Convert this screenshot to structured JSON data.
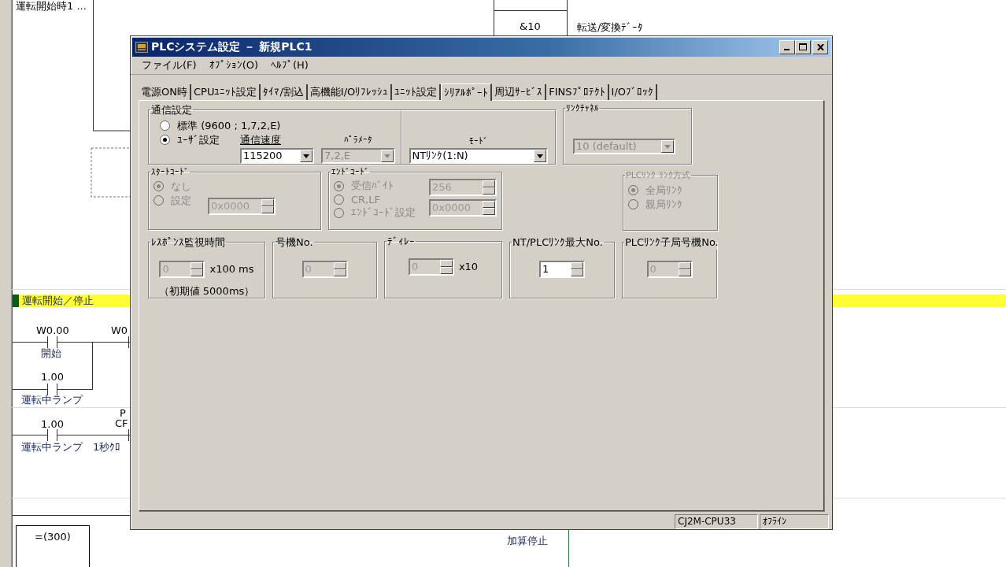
{
  "ladder": {
    "section_title": "運転開始／停止",
    "texts": [
      "運転開始時1 ...",
      "&10",
      "転送/変換ﾃﾞｰﾀ",
      "W0.00",
      "開始",
      "W0",
      "1.00",
      "運転中ランプ",
      "1.00",
      "運転中ランプ",
      "P",
      "CF",
      "1秒ｸﾛ",
      "加算停止"
    ],
    "compare_block": "=(300)"
  },
  "window": {
    "title": "PLCシステム設定 － 新規PLC1"
  },
  "menu": [
    "ファイル(F)",
    "ｵﾌﾟｼｮﾝ(O)",
    "ﾍﾙﾌﾟ(H)"
  ],
  "tabs": [
    {
      "label": "電源ON時",
      "selected": false
    },
    {
      "label": "CPUﾕﾆｯﾄ設定",
      "selected": false
    },
    {
      "label": "ﾀｲﾏ/割込",
      "selected": false
    },
    {
      "label": "高機能I/Oﾘﾌﾚｯｼｭ",
      "selected": false
    },
    {
      "label": "ﾕﾆｯﾄ設定",
      "selected": false
    },
    {
      "label": "ｼﾘｱﾙﾎﾟｰﾄ",
      "selected": true
    },
    {
      "label": "周辺ｻｰﾋﾞｽ",
      "selected": false
    },
    {
      "label": "FINSﾌﾟﾛﾃｸﾄ",
      "selected": false
    },
    {
      "label": "I/Oﾌﾞﾛｯｸ",
      "selected": false
    }
  ],
  "comm": {
    "title": "通信設定",
    "options": [
      {
        "label": "標準 (9600 ; 1,7,2,E)",
        "selected": false
      },
      {
        "label": "ﾕｰｻﾞ設定",
        "selected": true
      }
    ],
    "speed": {
      "label": "通信速度",
      "value": "115200",
      "disabled": false
    },
    "params": {
      "label": "ﾊﾟﾗﾒｰﾀ",
      "value": "7,2,E",
      "disabled": true
    },
    "mode": {
      "label": "ﾓｰﾄﾞ",
      "value": "NTﾘﾝｸ(1:N)",
      "disabled": false
    }
  },
  "link_channel": {
    "title": "ﾘﾝｸﾁｬﾈﾙ",
    "value": "10 (default)",
    "disabled": true
  },
  "start_code": {
    "title": "ｽﾀｰﾄｺｰﾄﾞ",
    "disabled": true,
    "options": [
      {
        "label": "なし",
        "selected": true
      },
      {
        "label": "設定",
        "selected": false
      }
    ],
    "value": "0x0000"
  },
  "end_code": {
    "title": "ｴﾝﾄﾞｺｰﾄﾞ",
    "disabled": true,
    "options": [
      {
        "label": "受信ﾊﾞｲﾄ",
        "selected": true
      },
      {
        "label": "CR,LF",
        "selected": false
      },
      {
        "label": "ｴﾝﾄﾞｺｰﾄﾞ設定",
        "selected": false
      }
    ],
    "byte_value": "256",
    "code_value": "0x0000"
  },
  "link_method": {
    "title": "PLCﾘﾝｸ ﾘﾝｸ方式",
    "disabled": true,
    "options": [
      {
        "label": "全局ﾘﾝｸ",
        "selected": true
      },
      {
        "label": "親局ﾘﾝｸ",
        "selected": false
      }
    ]
  },
  "spin_groups": [
    {
      "title": "ﾚｽﾎﾟﾝｽ監視時間",
      "value": "0",
      "disabled": true,
      "unit": "x100 ms",
      "note": "（初期値 5000ms）"
    },
    {
      "title": "号機No.",
      "value": "0",
      "disabled": true
    },
    {
      "title": "ﾃﾞｨﾚｰ",
      "value": "0",
      "disabled": true,
      "unit": "x10"
    },
    {
      "title": "NT/PLCﾘﾝｸ最大No.",
      "value": "1",
      "disabled": false
    },
    {
      "title": "PLCﾘﾝｸ子局号機No.",
      "value": "0",
      "disabled": true
    }
  ],
  "status_bar": [
    "CJ2M-CPU33",
    "ｵﾌﾗｲﾝ"
  ]
}
